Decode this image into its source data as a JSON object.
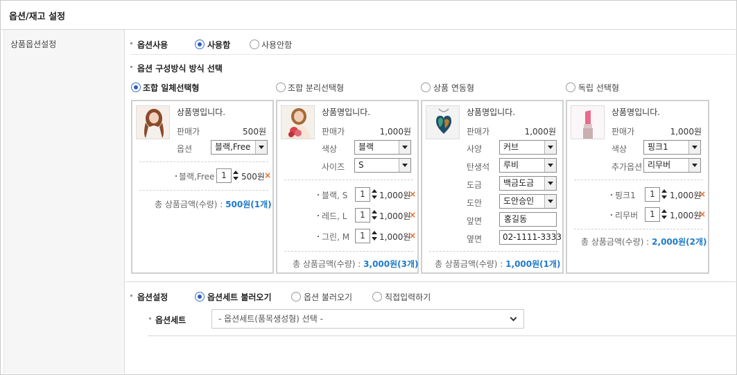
{
  "header": {
    "title": "옵션/재고 설정"
  },
  "left_label": "상품옵션설정",
  "option_use": {
    "label": "옵션사용",
    "options": [
      {
        "label": "사용함",
        "checked": true
      },
      {
        "label": "사용안함",
        "checked": false
      }
    ]
  },
  "option_method": {
    "label": "옵션 구성방식 방식 선택",
    "options": [
      {
        "label": "조합 일체선택형",
        "checked": true
      },
      {
        "label": "조합 분리선택형",
        "checked": false
      },
      {
        "label": "상품 연동형",
        "checked": false
      },
      {
        "label": "독립 선택형",
        "checked": false
      }
    ]
  },
  "panels": [
    {
      "product_name": "상품명입니다.",
      "price_label": "판매가",
      "price": "500원",
      "fields": [
        {
          "label": "옵션",
          "value": "블랙,Free"
        }
      ],
      "items": [
        {
          "name": "블랙,Free",
          "qty": "1",
          "price": "500원"
        }
      ],
      "total_label": "총 상품금액(수량) :",
      "total_value": "500원(1개)"
    },
    {
      "product_name": "상품명입니다.",
      "price_label": "판매가",
      "price": "1,000원",
      "fields": [
        {
          "label": "색상",
          "value": "블랙"
        },
        {
          "label": "사이즈",
          "value": "S"
        }
      ],
      "items": [
        {
          "name": "블랙, S",
          "qty": "1",
          "price": "1,000원"
        },
        {
          "name": "레드, L",
          "qty": "1",
          "price": "1,000원"
        },
        {
          "name": "그린, M",
          "qty": "1",
          "price": "1,000원"
        }
      ],
      "total_label": "총 상품금액(수량) :",
      "total_value": "3,000원(3개)"
    },
    {
      "product_name": "상품명입니다.",
      "price_label": "판매가",
      "price": "1,000원",
      "fields": [
        {
          "label": "사양",
          "value": "커브",
          "type": "select"
        },
        {
          "label": "탄생석",
          "value": "루비",
          "type": "select"
        },
        {
          "label": "도금",
          "value": "백금도금",
          "type": "select"
        },
        {
          "label": "도안",
          "value": "도안승인",
          "type": "select"
        },
        {
          "label": "앞면",
          "value": "홍길동",
          "type": "text"
        },
        {
          "label": "옆면",
          "value": "02-1111-3333",
          "type": "text"
        }
      ],
      "items": [],
      "total_label": "총 상품금액(수량) :",
      "total_value": "1,000원(1개)"
    },
    {
      "product_name": "상품명입니다.",
      "price_label": "판매가",
      "price": "1,000원",
      "fields": [
        {
          "label": "색상",
          "value": "핑크1"
        },
        {
          "label": "추가옵션",
          "value": "리무버"
        }
      ],
      "items": [
        {
          "name": "핑크1",
          "qty": "1",
          "price": "1,000원"
        },
        {
          "name": "리무버",
          "qty": "1",
          "price": "1,000원"
        }
      ],
      "total_label": "총 상품금액(수량) :",
      "total_value": "2,000원(2개)"
    }
  ],
  "option_setting": {
    "label": "옵션설정",
    "options": [
      {
        "label": "옵션세트 불러오기",
        "checked": true
      },
      {
        "label": "옵션 불러오기",
        "checked": false
      },
      {
        "label": "직접입력하기",
        "checked": false
      }
    ]
  },
  "option_set": {
    "label": "옵션세트",
    "selected": "- 옵션세트(품목생성형) 선택 -"
  },
  "colors": {
    "accent_blue": "#1f7ac9",
    "radio_blue": "#2b5fc0",
    "delete_orange": "#e06b2c"
  },
  "icons": {
    "delete": "close-x-icon",
    "spinner": "quantity-spinner-icon",
    "dropdown": "chevron-down-icon"
  }
}
